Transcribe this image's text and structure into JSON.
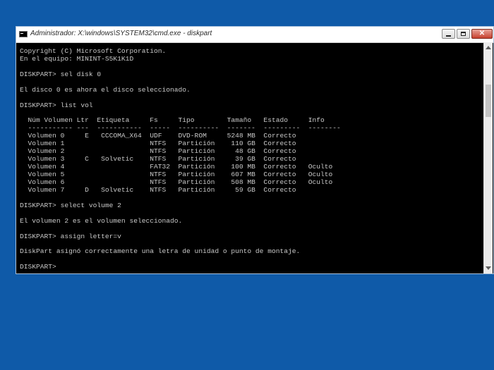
{
  "window": {
    "title": "Administrador: X:\\windows\\SYSTEM32\\cmd.exe - diskpart",
    "controls": {
      "minimize": "",
      "maximize": "",
      "close": "✕"
    }
  },
  "console": {
    "lines": [
      "Copyright (C) Microsoft Corporation.",
      "En el equipo: MININT-S5K1K1D",
      "",
      "DISKPART> sel disk 0",
      "",
      "El disco 0 es ahora el disco seleccionado.",
      "",
      "DISKPART> list vol",
      "",
      "  Núm Volumen Ltr  Etiqueta     Fs     Tipo        Tamaño   Estado     Info",
      "  ----------- ---  -----------  -----  ----------  -------  ---------  --------",
      "  Volumen 0     E   CCCOMA_X64  UDF    DVD-ROM     5248 MB  Correcto",
      "  Volumen 1                     NTFS   Partición    110 GB  Correcto",
      "  Volumen 2                     NTFS   Partición     48 GB  Correcto",
      "  Volumen 3     C   Solvetic    NTFS   Partición     39 GB  Correcto",
      "  Volumen 4                     FAT32  Partición    100 MB  Correcto   Oculto",
      "  Volumen 5                     NTFS   Partición    607 MB  Correcto   Oculto",
      "  Volumen 6                     NTFS   Partición    508 MB  Correcto   Oculto",
      "  Volumen 7     D   Solvetic    NTFS   Partición     59 GB  Correcto",
      "",
      "DISKPART> select volume 2",
      "",
      "El volumen 2 es el volumen seleccionado.",
      "",
      "DISKPART> assign letter=v",
      "",
      "DiskPart asignó correctamente una letra de unidad o punto de montaje.",
      "",
      "DISKPART>"
    ]
  },
  "colors": {
    "desktop": "#0f5aa8",
    "console_bg": "#000000",
    "console_text": "#c8c8c8"
  }
}
